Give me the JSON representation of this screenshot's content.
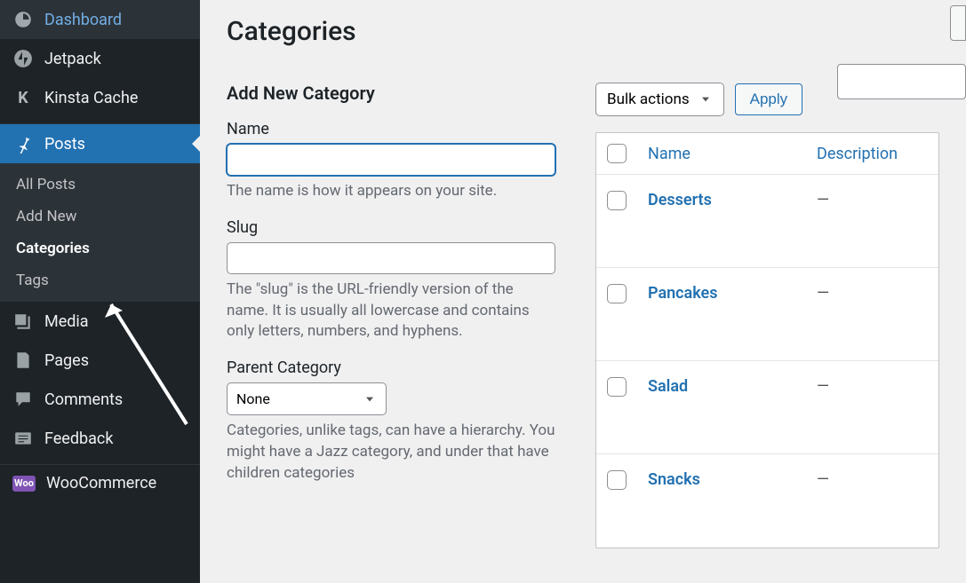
{
  "sidebar": {
    "items": [
      {
        "label": "Dashboard"
      },
      {
        "label": "Jetpack"
      },
      {
        "label": "Kinsta Cache"
      },
      {
        "label": "Posts"
      },
      {
        "label": "Media"
      },
      {
        "label": "Pages"
      },
      {
        "label": "Comments"
      },
      {
        "label": "Feedback"
      },
      {
        "label": "WooCommerce"
      }
    ],
    "posts_submenu": [
      {
        "label": "All Posts"
      },
      {
        "label": "Add New"
      },
      {
        "label": "Categories"
      },
      {
        "label": "Tags"
      }
    ]
  },
  "page": {
    "title": "Categories"
  },
  "form": {
    "heading": "Add New Category",
    "name_label": "Name",
    "name_help": "The name is how it appears on your site.",
    "slug_label": "Slug",
    "slug_help": "The \"slug\" is the URL-friendly version of the name. It is usually all lowercase and contains only letters, numbers, and hyphens.",
    "parent_label": "Parent Category",
    "parent_value": "None",
    "parent_help": "Categories, unlike tags, can have a hierarchy. You might have a Jazz category, and under that have children categories"
  },
  "bulk": {
    "label": "Bulk actions",
    "apply": "Apply"
  },
  "table": {
    "headers": {
      "name": "Name",
      "description": "Description"
    },
    "rows": [
      {
        "name": "Desserts",
        "description": "—"
      },
      {
        "name": "Pancakes",
        "description": "—"
      },
      {
        "name": "Salad",
        "description": "—"
      },
      {
        "name": "Snacks",
        "description": "—"
      }
    ]
  }
}
